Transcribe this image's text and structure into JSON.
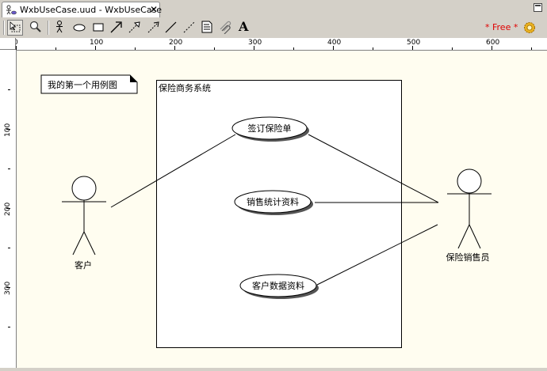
{
  "editor_tab": {
    "title": "WxbUseCase.uud - WxbUseCase",
    "close_glyph": "✕"
  },
  "toolbar": {
    "tools": [
      "select-tool",
      "zoom-tool",
      "actor-tool",
      "use-case-tool",
      "system-boundary-tool",
      "association-tool",
      "generalization-tool",
      "include-tool",
      "line-tool",
      "dependency-tool",
      "note-tool",
      "note-link-tool",
      "text-tool"
    ],
    "text_tool_glyph": "A",
    "license_label": "* Free *"
  },
  "ruler": {
    "horizontal_labels": [
      "0",
      "100",
      "200",
      "300",
      "400",
      "500",
      "600"
    ],
    "vertical_labels": [
      "100",
      "200",
      "300"
    ]
  },
  "diagram": {
    "note": "我的第一个用例图",
    "system_boundary": "保险商务系统",
    "actors": [
      "客户",
      "保险销售员"
    ],
    "use_cases": [
      "签订保险单",
      "销售统计资料",
      "客户数据资料"
    ]
  },
  "colors": {
    "canvas_background": "#fffdf0",
    "license_label": "#e00000",
    "chrome": "#d4d0c8"
  }
}
